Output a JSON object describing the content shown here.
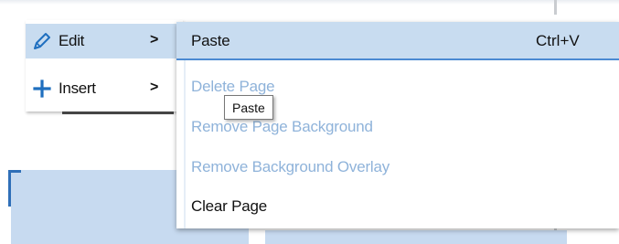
{
  "parent_menu": {
    "items": [
      {
        "label": "Edit",
        "icon": "pencil-icon",
        "has_submenu": true,
        "active": true
      },
      {
        "label": "Insert",
        "icon": "plus-icon",
        "has_submenu": true,
        "active": false
      }
    ],
    "submenu_arrow": ">"
  },
  "submenu": {
    "items": [
      {
        "label": "Paste",
        "shortcut": "Ctrl+V",
        "enabled": true,
        "highlighted": true
      },
      {
        "label": "Delete Page",
        "enabled": false
      },
      {
        "label": "Remove Page Background",
        "enabled": false
      },
      {
        "label": "Remove Background Overlay",
        "enabled": false
      },
      {
        "label": "Clear Page",
        "enabled": true
      }
    ]
  },
  "tooltip": {
    "text": "Paste"
  },
  "colors": {
    "highlight": "#c8dcf0",
    "highlight_border": "#4b8ad2",
    "disabled_text": "#8fb3da",
    "icon_blue": "#1f6fbf"
  }
}
